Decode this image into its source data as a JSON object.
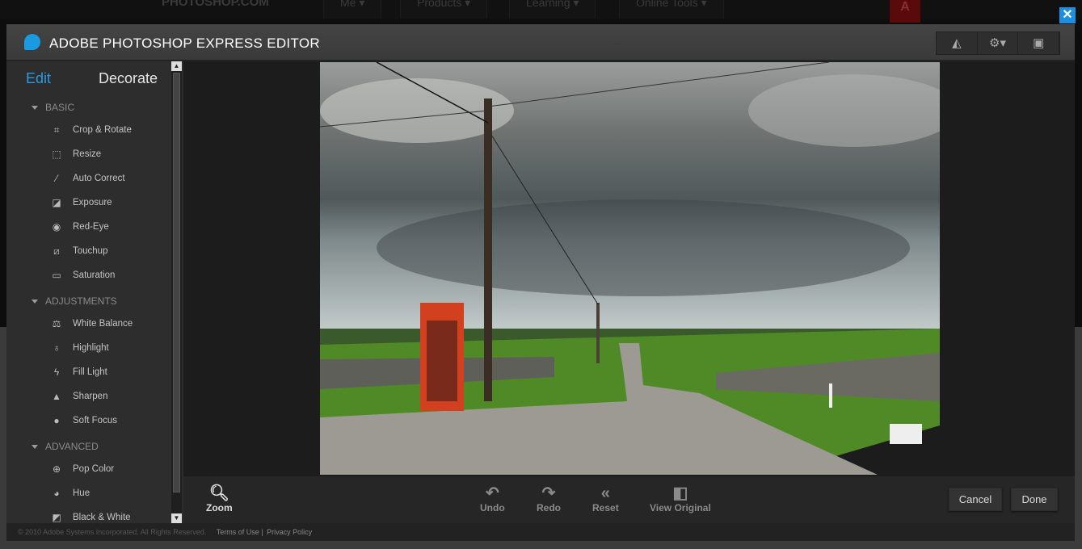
{
  "site_nav": {
    "logo": "PHOTOSHOP.COM",
    "items": [
      "Me ▾",
      "Products ▾",
      "Learning ▾",
      "Online Tools ▾"
    ],
    "adobe": "A"
  },
  "close_label": "✕",
  "header": {
    "title": "ADOBE PHOTOSHOP EXPRESS EDITOR",
    "tools": [
      {
        "icon": "megaphone-icon",
        "glyph": "◭"
      },
      {
        "icon": "gear-icon",
        "glyph": "⚙▾"
      },
      {
        "icon": "fullscreen-icon",
        "glyph": "▣"
      }
    ]
  },
  "sidebar": {
    "tabs": [
      "Edit",
      "Decorate"
    ],
    "active_tab": "Edit",
    "sections": [
      {
        "label": "BASIC",
        "items": [
          {
            "label": "Crop & Rotate",
            "glyph": "⌗"
          },
          {
            "label": "Resize",
            "glyph": "⬚"
          },
          {
            "label": "Auto Correct",
            "glyph": "⁄"
          },
          {
            "label": "Exposure",
            "glyph": "◪"
          },
          {
            "label": "Red-Eye",
            "glyph": "◉"
          },
          {
            "label": "Touchup",
            "glyph": "⧄"
          },
          {
            "label": "Saturation",
            "glyph": "▭"
          }
        ]
      },
      {
        "label": "ADJUSTMENTS",
        "items": [
          {
            "label": "White Balance",
            "glyph": "⚖"
          },
          {
            "label": "Highlight",
            "glyph": "♁"
          },
          {
            "label": "Fill Light",
            "glyph": "ϟ"
          },
          {
            "label": "Sharpen",
            "glyph": "▲"
          },
          {
            "label": "Soft Focus",
            "glyph": "●"
          }
        ]
      },
      {
        "label": "ADVANCED",
        "items": [
          {
            "label": "Pop Color",
            "glyph": "⊕"
          },
          {
            "label": "Hue",
            "glyph": "◕"
          },
          {
            "label": "Black & White",
            "glyph": "◩"
          }
        ]
      }
    ]
  },
  "toolbar": {
    "zoom": "Zoom",
    "undo": "Undo",
    "redo": "Redo",
    "reset": "Reset",
    "view_original": "View Original",
    "cancel": "Cancel",
    "done": "Done"
  },
  "footer": {
    "copyright": "© 2010 Adobe Systems Incorporated. All Rights Reserved.",
    "terms": "Terms of Use",
    "privacy": "Privacy Policy"
  },
  "colors": {
    "accent": "#2b9ae6",
    "background": "#262626"
  }
}
